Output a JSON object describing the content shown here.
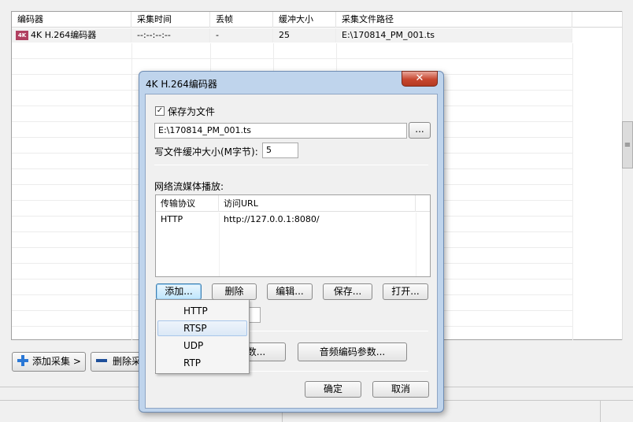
{
  "background_window": {
    "columns": [
      "编码器",
      "采集时间",
      "丢帧",
      "缓冲大小",
      "采集文件路径"
    ],
    "row": {
      "icon": "4k-encoder-icon",
      "icon_text": "4K",
      "encoder": "4K H.264编码器",
      "capture_time": "--:--:--:--",
      "dropped_frames": "-",
      "buffer_size": "25",
      "file_path": "E:\\170814_PM_001.ts"
    },
    "buttons": {
      "add_capture": "添加采集 >",
      "delete": "删除采"
    },
    "scrollbar_glyph": "≡"
  },
  "dialog": {
    "title": "4K H.264编码器",
    "close_glyph": "✕",
    "save_to_file_label": "保存为文件",
    "save_to_file_checked": true,
    "file_path_value": "E:\\170814_PM_001.ts",
    "browse_label": "...",
    "buffer_label": "写文件缓冲大小(M字节):",
    "buffer_value": "5",
    "streaming_label": "网络流媒体播放:",
    "stream_table": {
      "columns": [
        "传输协议",
        "访问URL"
      ],
      "rows": [
        {
          "protocol": "HTTP",
          "url": "http://127.0.0.1:8080/"
        }
      ]
    },
    "buttons": {
      "add": "添加...",
      "delete": "删除",
      "edit": "编辑...",
      "save": "保存...",
      "open": "打开...",
      "video_params_partial": "数...",
      "audio_params": "音频编码参数...",
      "ok": "确定",
      "cancel": "取消"
    }
  },
  "dropdown": {
    "items": [
      "HTTP",
      "RTSP",
      "UDP",
      "RTP"
    ],
    "highlighted": "RTSP"
  },
  "colors": {
    "dialog_frame": "#bfd4ec",
    "close_button": "#c7472f",
    "highlight": "#dbe8f6"
  }
}
